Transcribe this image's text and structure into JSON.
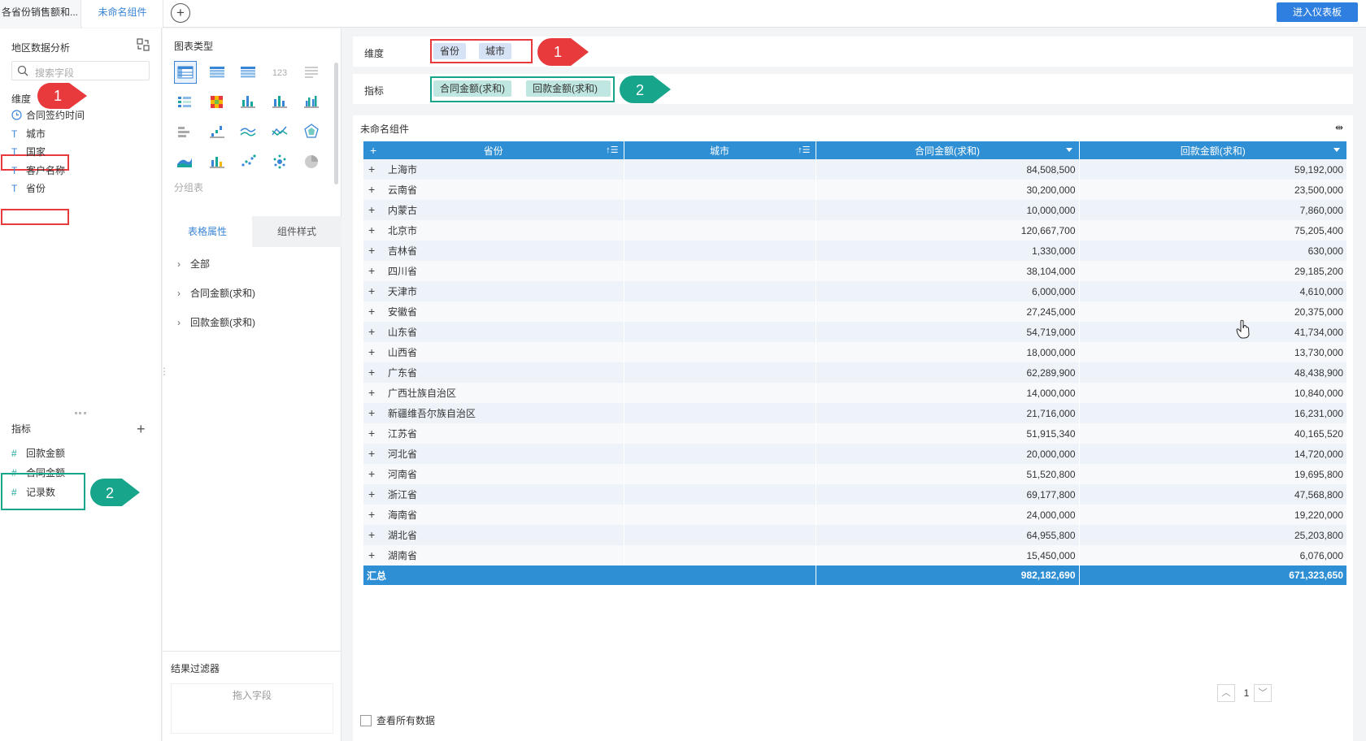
{
  "tabs": [
    {
      "label": "各省份销售额和..."
    },
    {
      "label": "未命名组件"
    }
  ],
  "topbar": {
    "enter_dashboard": "进入仪表板"
  },
  "left": {
    "dataset_title": "地区数据分析",
    "search_placeholder": "搜索字段",
    "dimension_label": "维度",
    "dimensions": [
      {
        "label": "合同签约时间",
        "type": "date"
      },
      {
        "label": "城市",
        "type": "text"
      },
      {
        "label": "国家",
        "type": "text"
      },
      {
        "label": "客户名称",
        "type": "text"
      },
      {
        "label": "省份",
        "type": "text"
      }
    ],
    "measure_label": "指标",
    "measures": [
      {
        "label": "回款金额"
      },
      {
        "label": "合同金额"
      },
      {
        "label": "记录数"
      }
    ]
  },
  "middle": {
    "chart_type_label": "图表类型",
    "group_label": "分组表",
    "tab_active": "表格属性",
    "tab_inactive": "组件样式",
    "prop_items": [
      "全部",
      "合同金额(求和)",
      "回款金额(求和)"
    ],
    "filter_label": "结果过滤器",
    "filter_placeholder": "拖入字段"
  },
  "main": {
    "dimension_label": "维度",
    "dimension_pills": [
      "省份",
      "城市"
    ],
    "measure_label": "指标",
    "measure_pills": [
      "合同金额(求和)",
      "回款金额(求和)"
    ],
    "widget_title": "未命名组件",
    "table": {
      "headers": [
        "省份",
        "城市",
        "合同金额(求和)",
        "回款金额(求和)"
      ],
      "rows": [
        [
          "上海市",
          "84,508,500",
          "59,192,000"
        ],
        [
          "云南省",
          "30,200,000",
          "23,500,000"
        ],
        [
          "内蒙古",
          "10,000,000",
          "7,860,000"
        ],
        [
          "北京市",
          "120,667,700",
          "75,205,400"
        ],
        [
          "吉林省",
          "1,330,000",
          "630,000"
        ],
        [
          "四川省",
          "38,104,000",
          "29,185,200"
        ],
        [
          "天津市",
          "6,000,000",
          "4,610,000"
        ],
        [
          "安徽省",
          "27,245,000",
          "20,375,000"
        ],
        [
          "山东省",
          "54,719,000",
          "41,734,000"
        ],
        [
          "山西省",
          "18,000,000",
          "13,730,000"
        ],
        [
          "广东省",
          "62,289,900",
          "48,438,900"
        ],
        [
          "广西壮族自治区",
          "14,000,000",
          "10,840,000"
        ],
        [
          "新疆维吾尔族自治区",
          "21,716,000",
          "16,231,000"
        ],
        [
          "江苏省",
          "51,915,340",
          "40,165,520"
        ],
        [
          "河北省",
          "20,000,000",
          "14,720,000"
        ],
        [
          "河南省",
          "51,520,800",
          "19,695,800"
        ],
        [
          "浙江省",
          "69,177,800",
          "47,568,800"
        ],
        [
          "海南省",
          "24,000,000",
          "19,220,000"
        ],
        [
          "湖北省",
          "64,955,800",
          "25,203,800"
        ],
        [
          "湖南省",
          "15,450,000",
          "6,076,000"
        ]
      ],
      "total_label": "汇总",
      "total_contract": "982,182,690",
      "total_payment": "671,323,650"
    },
    "view_all": "查看所有数据",
    "page": "1"
  },
  "annotations": {
    "one": "1",
    "two": "2"
  },
  "colors": {
    "accent": "#2f8fd4",
    "red_marker": "#e8393c",
    "green_marker": "#17a58c"
  }
}
